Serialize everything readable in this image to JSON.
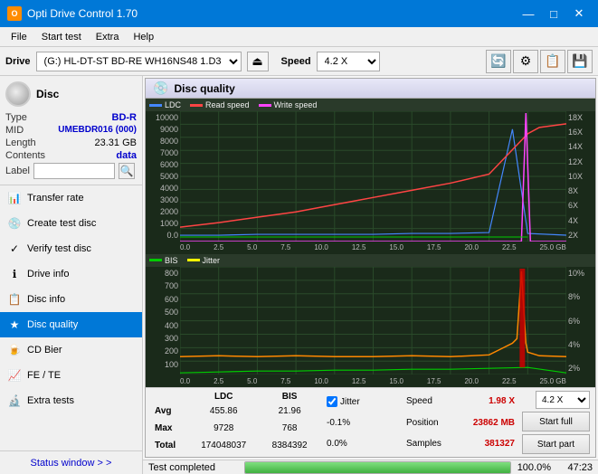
{
  "window": {
    "title": "Opti Drive Control 1.70",
    "icon_label": "O",
    "minimize_label": "—",
    "maximize_label": "□",
    "close_label": "✕"
  },
  "menu": {
    "items": [
      "File",
      "Start test",
      "Extra",
      "Help"
    ]
  },
  "drive_bar": {
    "drive_label": "Drive",
    "drive_value": "(G:)  HL-DT-ST BD-RE  WH16NS48 1.D3",
    "speed_label": "Speed",
    "speed_value": "4.2 X"
  },
  "disc": {
    "header": "Disc",
    "type_label": "Type",
    "type_value": "BD-R",
    "mid_label": "MID",
    "mid_value": "UMEBDR016 (000)",
    "length_label": "Length",
    "length_value": "23.31 GB",
    "contents_label": "Contents",
    "contents_value": "data",
    "label_label": "Label",
    "label_value": ""
  },
  "sidebar": {
    "items": [
      {
        "id": "transfer-rate",
        "label": "Transfer rate",
        "icon": "📊"
      },
      {
        "id": "create-test-disc",
        "label": "Create test disc",
        "icon": "💿"
      },
      {
        "id": "verify-test-disc",
        "label": "Verify test disc",
        "icon": "✓"
      },
      {
        "id": "drive-info",
        "label": "Drive info",
        "icon": "ℹ"
      },
      {
        "id": "disc-info",
        "label": "Disc info",
        "icon": "📋"
      },
      {
        "id": "disc-quality",
        "label": "Disc quality",
        "icon": "★",
        "active": true
      },
      {
        "id": "cd-bier",
        "label": "CD Bier",
        "icon": "🍺"
      },
      {
        "id": "fe-te",
        "label": "FE / TE",
        "icon": "📈"
      },
      {
        "id": "extra-tests",
        "label": "Extra tests",
        "icon": "🔬"
      }
    ],
    "status_window_label": "Status window > >"
  },
  "disc_quality": {
    "title": "Disc quality",
    "chart1": {
      "legend": [
        {
          "label": "LDC",
          "color": "#0080ff"
        },
        {
          "label": "Read speed",
          "color": "#ff0000"
        },
        {
          "label": "Write speed",
          "color": "#ff00ff"
        }
      ],
      "y_axis_left": [
        "10000",
        "9000",
        "8000",
        "7000",
        "6000",
        "5000",
        "4000",
        "3000",
        "2000",
        "1000",
        "0.0"
      ],
      "y_axis_right": [
        "18X",
        "16X",
        "14X",
        "12X",
        "10X",
        "8X",
        "6X",
        "4X",
        "2X"
      ],
      "x_axis": [
        "0.0",
        "2.5",
        "5.0",
        "7.5",
        "10.0",
        "12.5",
        "15.0",
        "17.5",
        "20.0",
        "22.5",
        "25.0 GB"
      ]
    },
    "chart2": {
      "legend": [
        {
          "label": "BIS",
          "color": "#00ff00"
        },
        {
          "label": "Jitter",
          "color": "#ffff00"
        }
      ],
      "y_axis_left": [
        "800",
        "700",
        "600",
        "500",
        "400",
        "300",
        "200",
        "100",
        ""
      ],
      "y_axis_right": [
        "10%",
        "8%",
        "6%",
        "4%",
        "2%"
      ],
      "x_axis": [
        "0.0",
        "2.5",
        "5.0",
        "7.5",
        "10.0",
        "12.5",
        "15.0",
        "17.5",
        "20.0",
        "22.5",
        "25.0 GB"
      ]
    },
    "stats": {
      "headers": [
        "LDC",
        "BIS",
        "",
        "Jitter"
      ],
      "avg_label": "Avg",
      "avg_ldc": "455.86",
      "avg_bis": "21.96",
      "avg_jitter": "-0.1%",
      "max_label": "Max",
      "max_ldc": "9728",
      "max_bis": "768",
      "max_jitter": "0.0%",
      "total_label": "Total",
      "total_ldc": "174048037",
      "total_bis": "8384392",
      "jitter_label": "Jitter",
      "speed_label": "Speed",
      "speed_value": "1.98 X",
      "position_label": "Position",
      "position_value": "23862 MB",
      "samples_label": "Samples",
      "samples_value": "381327",
      "speed_select_value": "4.2 X",
      "start_full_label": "Start full",
      "start_part_label": "Start part"
    }
  },
  "bottom_bar": {
    "status_text": "Test completed",
    "progress_pct": "100.0%",
    "time_text": "47:23"
  }
}
